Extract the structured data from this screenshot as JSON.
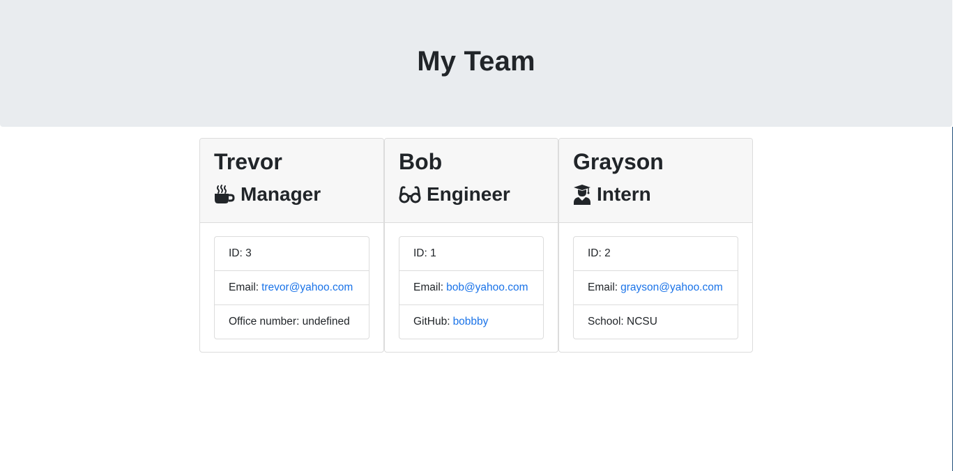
{
  "header": {
    "title": "My Team"
  },
  "team": [
    {
      "name": "Trevor",
      "role": "Manager",
      "role_icon": "mug-hot-icon",
      "id_label": "ID: 3",
      "email_label": "Email:",
      "email": "trevor@yahoo.com",
      "extra_label": "Office number: undefined",
      "extra_link": ""
    },
    {
      "name": "Bob",
      "role": "Engineer",
      "role_icon": "glasses-icon",
      "id_label": "ID: 1",
      "email_label": "Email:",
      "email": "bob@yahoo.com",
      "extra_label": "GitHub:",
      "extra_link": "bobbby"
    },
    {
      "name": "Grayson",
      "role": "Intern",
      "role_icon": "graduate-icon",
      "id_label": "ID: 2",
      "email_label": "Email:",
      "email": "grayson@yahoo.com",
      "extra_label": "School: NCSU",
      "extra_link": ""
    }
  ],
  "colors": {
    "jumbotron_bg": "#e9ecef",
    "card_header_bg": "#f7f7f7",
    "link": "#1a73e8",
    "text": "#212529"
  }
}
